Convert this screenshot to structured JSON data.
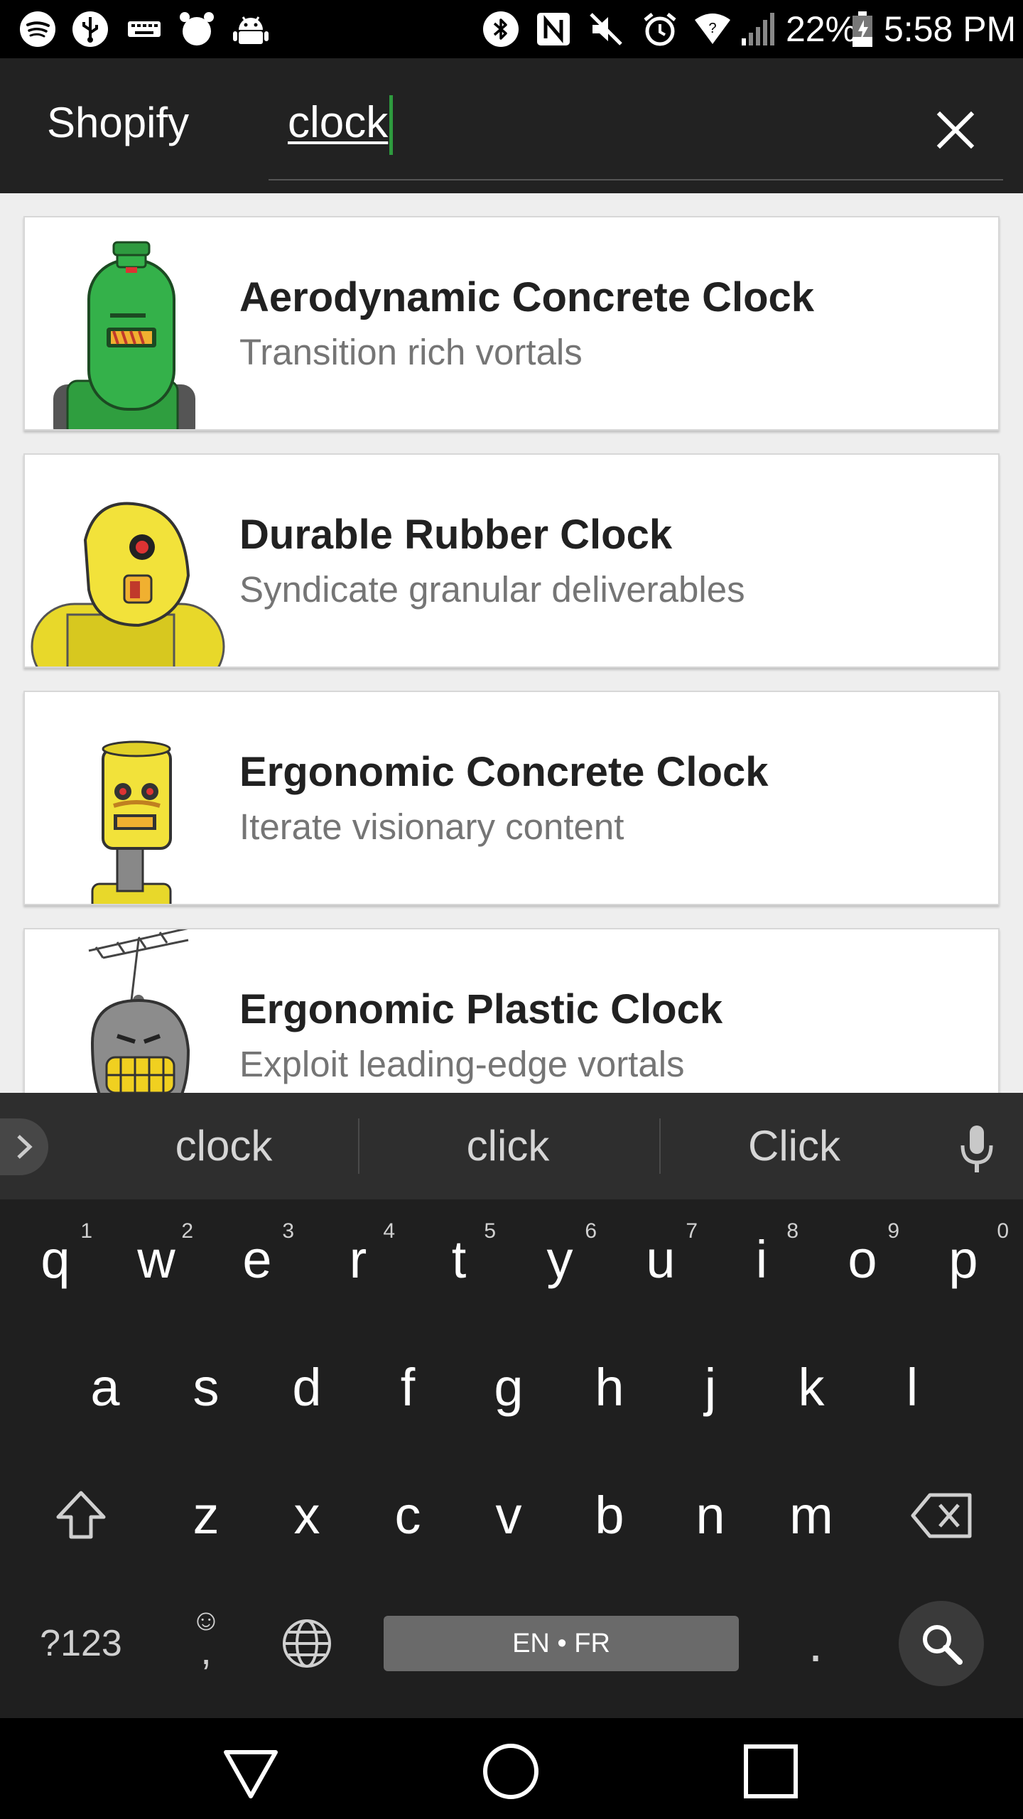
{
  "status_bar": {
    "left_icons": [
      "spotify-icon",
      "usb-icon",
      "keyboard-icon",
      "alarm-clock-icon",
      "android-icon"
    ],
    "right_icons": [
      "bluetooth-icon",
      "nfc-icon",
      "mute-icon",
      "alarm-icon",
      "wifi-icon",
      "signal-icon",
      "battery-icon"
    ],
    "battery": "22%",
    "time": "5:58 PM"
  },
  "app_bar": {
    "title": "Shopify",
    "search_value": "clock",
    "clear_icon": "close-icon",
    "caret_color": "#2e9b3e"
  },
  "results": [
    {
      "title": "Aerodynamic Concrete Clock",
      "subtitle": "Transition rich vortals",
      "image": "green-robot"
    },
    {
      "title": "Durable Rubber Clock",
      "subtitle": "Syndicate granular deliverables",
      "image": "yellow-hooded-robot"
    },
    {
      "title": "Ergonomic Concrete Clock",
      "subtitle": "Iterate visionary content",
      "image": "yellow-can-robot"
    },
    {
      "title": "Ergonomic Plastic Clock",
      "subtitle": "Exploit leading-edge vortals",
      "image": "grey-antenna-robot"
    }
  ],
  "keyboard": {
    "suggestions": [
      "clock",
      "click",
      "Click"
    ],
    "row1": [
      {
        "k": "q",
        "h": "1"
      },
      {
        "k": "w",
        "h": "2"
      },
      {
        "k": "e",
        "h": "3"
      },
      {
        "k": "r",
        "h": "4"
      },
      {
        "k": "t",
        "h": "5"
      },
      {
        "k": "y",
        "h": "6"
      },
      {
        "k": "u",
        "h": "7"
      },
      {
        "k": "i",
        "h": "8"
      },
      {
        "k": "o",
        "h": "9"
      },
      {
        "k": "p",
        "h": "0"
      }
    ],
    "row2": [
      "a",
      "s",
      "d",
      "f",
      "g",
      "h",
      "j",
      "k",
      "l"
    ],
    "row3": [
      "z",
      "x",
      "c",
      "v",
      "b",
      "n",
      "m"
    ],
    "symbols_label": "?123",
    "emoji_key": "☺",
    "emoji_sub": ",",
    "space_label": "EN • FR",
    "period": ".",
    "icons": [
      "shift-icon",
      "backspace-icon",
      "globe-icon",
      "search-icon",
      "mic-icon",
      "chevron-right-icon"
    ]
  },
  "nav_bar": {
    "icons": [
      "back-icon",
      "home-icon",
      "recents-icon"
    ]
  }
}
